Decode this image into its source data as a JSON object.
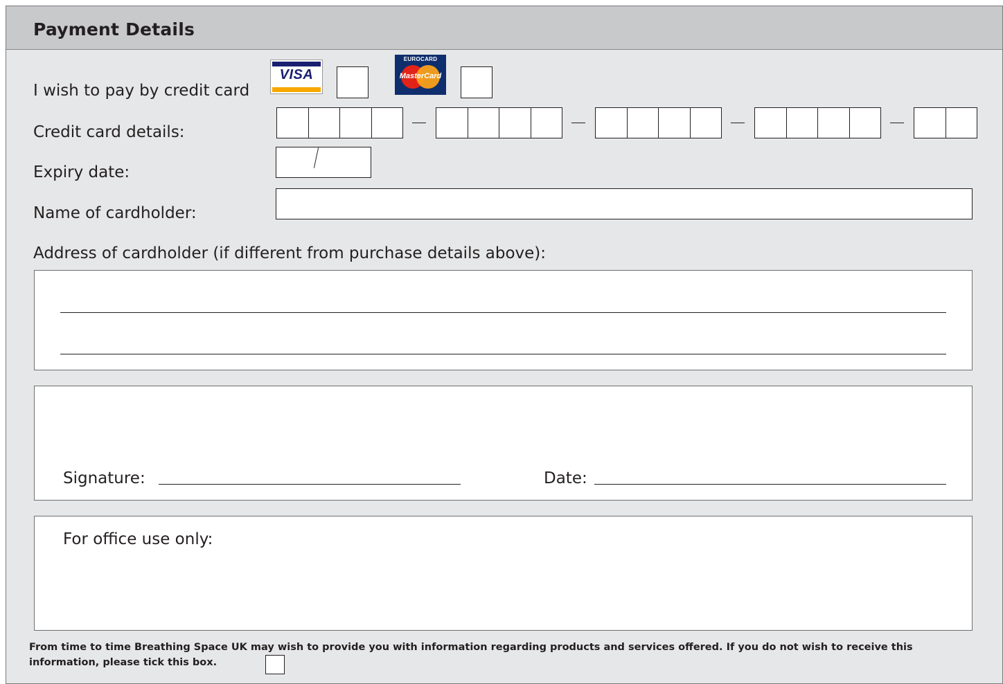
{
  "form": {
    "title": "Payment Details",
    "pay_by_card_label": "I wish to pay by credit card",
    "card_logos": {
      "visa": {
        "text": "VISA",
        "colors": [
          "#1a1f71",
          "#f7a800"
        ]
      },
      "mastercard": {
        "top_text": "EUROCARD",
        "text": "MasterCard",
        "colors": [
          "#0f2e6d",
          "#e2231a",
          "#f9a11b"
        ]
      }
    },
    "card_details_label": "Credit card details:",
    "card_number_groups": [
      4,
      4,
      4,
      4,
      2
    ],
    "expiry_label": "Expiry date:",
    "cardholder_name_label": "Name of cardholder:",
    "address_label": "Address of cardholder (if different from purchase details above):",
    "signature_label": "Signature:",
    "date_label": "Date:",
    "office_use_label": "For office use only:",
    "notice": "From time to time Breathing Space UK may wish to provide you with information regarding products and services offered. If you do not wish to receive this information, please tick this box."
  }
}
